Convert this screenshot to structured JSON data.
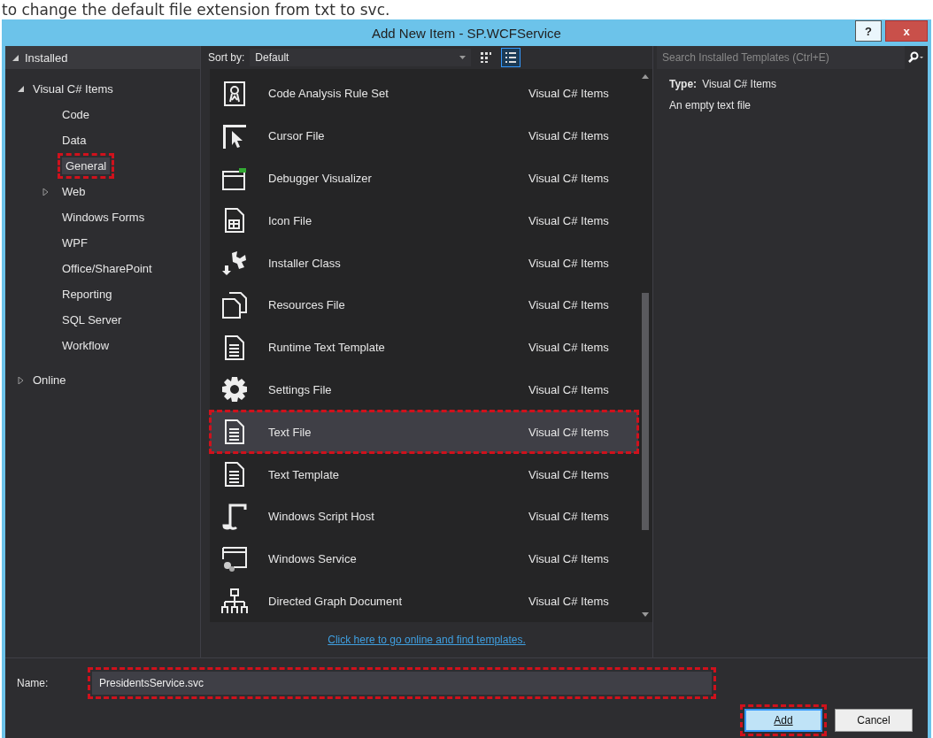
{
  "caption": "to change the default file extension from txt to svc.",
  "window": {
    "title": "Add New Item - SP.WCFService",
    "help": "?",
    "close": "x"
  },
  "tree": {
    "header": {
      "label": "Installed",
      "expanded": true
    },
    "items": [
      {
        "label": "Visual C# Items",
        "expanded": true,
        "children": [
          {
            "label": "Code",
            "selected": false,
            "highlighted": false
          },
          {
            "label": "Data",
            "selected": false,
            "highlighted": false
          },
          {
            "label": "General",
            "selected": true,
            "highlighted": true
          },
          {
            "label": "Web",
            "expanded": false,
            "selected": false,
            "highlighted": false
          },
          {
            "label": "Windows Forms",
            "selected": false,
            "highlighted": false
          },
          {
            "label": "WPF",
            "selected": false,
            "highlighted": false
          },
          {
            "label": "Office/SharePoint",
            "selected": false,
            "highlighted": false
          },
          {
            "label": "Reporting",
            "selected": false,
            "highlighted": false
          },
          {
            "label": "SQL Server",
            "selected": false,
            "highlighted": false
          },
          {
            "label": "Workflow",
            "selected": false,
            "highlighted": false
          }
        ]
      },
      {
        "label": "Online",
        "expanded": false
      }
    ]
  },
  "sort": {
    "label": "Sort by:",
    "value": "Default"
  },
  "view_buttons": [
    {
      "kind": "tiles",
      "selected": false
    },
    {
      "kind": "list",
      "selected": true
    }
  ],
  "search": {
    "placeholder": "Search Installed Templates (Ctrl+E)"
  },
  "templates": [
    {
      "kind": "ruleset",
      "name": "Code Analysis Rule Set",
      "category": "Visual C# Items",
      "selected": false,
      "highlighted": false
    },
    {
      "kind": "cursor",
      "name": "Cursor File",
      "category": "Visual C# Items",
      "selected": false,
      "highlighted": false
    },
    {
      "kind": "debugger",
      "name": "Debugger Visualizer",
      "category": "Visual C# Items",
      "selected": false,
      "highlighted": false
    },
    {
      "kind": "iconfile",
      "name": "Icon File",
      "category": "Visual C# Items",
      "selected": false,
      "highlighted": false
    },
    {
      "kind": "installer",
      "name": "Installer Class",
      "category": "Visual C# Items",
      "selected": false,
      "highlighted": false
    },
    {
      "kind": "resources",
      "name": "Resources File",
      "category": "Visual C# Items",
      "selected": false,
      "highlighted": false
    },
    {
      "kind": "document",
      "name": "Runtime Text Template",
      "category": "Visual C# Items",
      "selected": false,
      "highlighted": false
    },
    {
      "kind": "gear",
      "name": "Settings File",
      "category": "Visual C# Items",
      "selected": false,
      "highlighted": false
    },
    {
      "kind": "document",
      "name": "Text File",
      "category": "Visual C# Items",
      "selected": true,
      "highlighted": true
    },
    {
      "kind": "document",
      "name": "Text Template",
      "category": "Visual C# Items",
      "selected": false,
      "highlighted": false
    },
    {
      "kind": "script",
      "name": "Windows Script Host",
      "category": "Visual C# Items",
      "selected": false,
      "highlighted": false
    },
    {
      "kind": "service",
      "name": "Windows Service",
      "category": "Visual C# Items",
      "selected": false,
      "highlighted": false
    },
    {
      "kind": "graph",
      "name": "Directed Graph Document",
      "category": "Visual C# Items",
      "selected": false,
      "highlighted": false
    }
  ],
  "online_link": "Click here to go online and find templates.",
  "details": {
    "type_label": "Type:",
    "type_value": "Visual C# Items",
    "description": "An empty text file"
  },
  "name_field": {
    "label": "Name:",
    "value": "PresidentsService.svc",
    "highlighted": true
  },
  "buttons": [
    {
      "label": "Add",
      "default": true,
      "highlighted": true
    },
    {
      "label": "Cancel",
      "default": false,
      "highlighted": false
    }
  ]
}
